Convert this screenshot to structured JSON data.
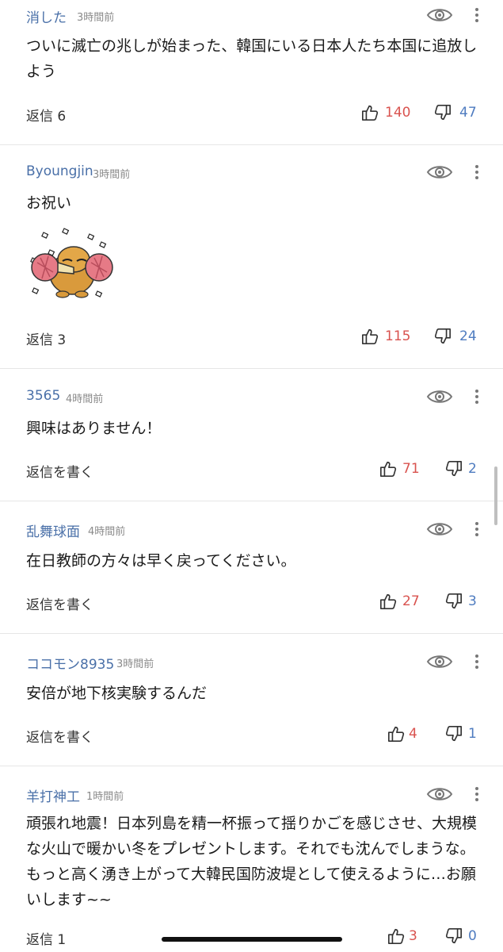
{
  "comments": [
    {
      "author": "消した",
      "time": "3時間前",
      "body": "ついに滅亡の兆しが始まった、韓国にいる日本人たち本国に追放しよう",
      "reply": "返信 6",
      "likes": "140",
      "dislikes": "47"
    },
    {
      "author": "Byoungjin",
      "time": "3時間前",
      "body": "お祝い",
      "sticker": "celebration-sticker",
      "reply": "返信 3",
      "likes": "115",
      "dislikes": "24"
    },
    {
      "author": "3565",
      "time": "4時間前",
      "body": "興味はありません！",
      "reply": "返信を書く",
      "likes": "71",
      "dislikes": "2"
    },
    {
      "author": "乱舞球面",
      "time": "4時間前",
      "body": "在日教師の方々は早く戻ってください。",
      "reply": "返信を書く",
      "likes": "27",
      "dislikes": "3"
    },
    {
      "author": "ココモン8935",
      "time": "3時間前",
      "body": "安倍が地下核実験するんだ",
      "reply": "返信を書く",
      "likes": "4",
      "dislikes": "1"
    },
    {
      "author": "羊打神工",
      "time": "1時間前",
      "body": "頑張れ地震！日本列島を精一杯振って揺りかごを感じさせ、大規模な火山で暖かい冬をプレゼントします。それでも沈んでしまうな。もっと高く湧き上がって大韓民国防波堤として使えるように…お願いします~~",
      "reply": "返信 1",
      "likes": "3",
      "dislikes": "0"
    }
  ],
  "icons": {
    "view": "eye-icon",
    "more": "more-vertical-icon",
    "like": "thumbs-up-icon",
    "dislike": "thumbs-down-icon"
  },
  "colors": {
    "author": "#4a70a8",
    "like": "#d9534f",
    "dislike": "#4f7cc0",
    "divider": "#e6e6e6"
  }
}
